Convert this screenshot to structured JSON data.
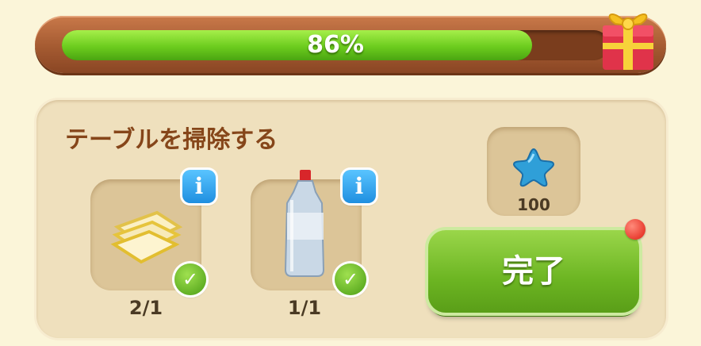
{
  "progress": {
    "value": 0.86,
    "label": "86%"
  },
  "task": {
    "title": "テーブルを掃除する",
    "items": [
      {
        "icon": "cloth-icon",
        "count": "2/1"
      },
      {
        "icon": "bottle-icon",
        "count": "1/1"
      }
    ]
  },
  "reward": {
    "icon": "blue-star-icon",
    "value": "100"
  },
  "complete_button": {
    "label": "完了"
  },
  "colors": {
    "progress_fill": "#6ccc1e",
    "button_green": "#6cb522",
    "title_brown": "#86461a",
    "info_blue": "#1f8fe0",
    "notification_red": "#e01d12"
  }
}
